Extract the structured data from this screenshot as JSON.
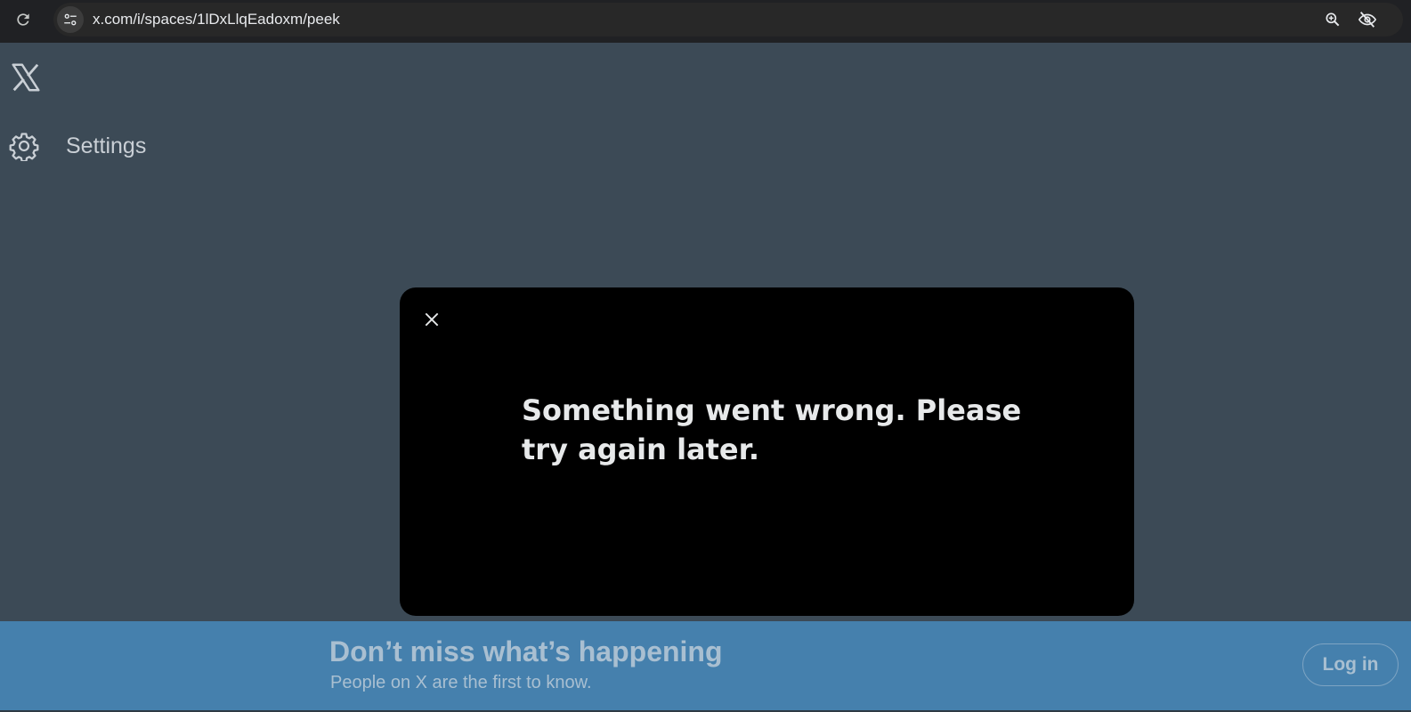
{
  "browser": {
    "url": "x.com/i/spaces/1lDxLlqEadoxm/peek",
    "icons": {
      "reload": "reload-icon",
      "site_info": "tune-icon",
      "zoom": "zoom-in-icon",
      "visibility": "eye-off-icon"
    }
  },
  "sidebar": {
    "logo": "x-logo-icon",
    "settings_label": "Settings"
  },
  "modal": {
    "message": "Something went wrong. Please try again later."
  },
  "banner": {
    "title": "Don’t miss what’s happening",
    "subtitle": "People on X are the first to know.",
    "login_label": "Log in"
  },
  "colors": {
    "page_bg": "#3c4a56",
    "modal_bg": "#000000",
    "banner_bg": "#4580ad",
    "chrome_bg": "#202124"
  }
}
